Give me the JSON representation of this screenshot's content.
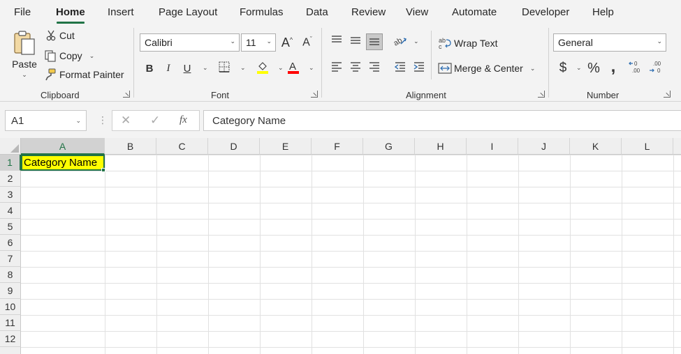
{
  "menu": {
    "tabs": [
      "File",
      "Home",
      "Insert",
      "Page Layout",
      "Formulas",
      "Data",
      "Review",
      "View",
      "Automate",
      "Developer",
      "Help"
    ]
  },
  "clipboard": {
    "paste": "Paste",
    "cut": "Cut",
    "copy": "Copy",
    "format_painter": "Format Painter",
    "label": "Clipboard"
  },
  "font": {
    "name": "Calibri",
    "size": "11",
    "label": "Font",
    "fill_color": "#ffff00",
    "font_color": "#ff0000"
  },
  "alignment": {
    "wrap_text": "Wrap Text",
    "merge_center": "Merge & Center",
    "label": "Alignment"
  },
  "number": {
    "format": "General",
    "label": "Number"
  },
  "formula_bar": {
    "name_box": "A1",
    "content": "Category Name"
  },
  "sheet": {
    "columns": [
      "A",
      "B",
      "C",
      "D",
      "E",
      "F",
      "G",
      "H",
      "I",
      "J",
      "K",
      "L"
    ],
    "rows": [
      "1",
      "2",
      "3",
      "4",
      "5",
      "6",
      "7",
      "8",
      "9",
      "10",
      "11",
      "12"
    ],
    "a1_value": "Category Name",
    "a1_fill": "#ffff00",
    "accent": "#217346"
  }
}
